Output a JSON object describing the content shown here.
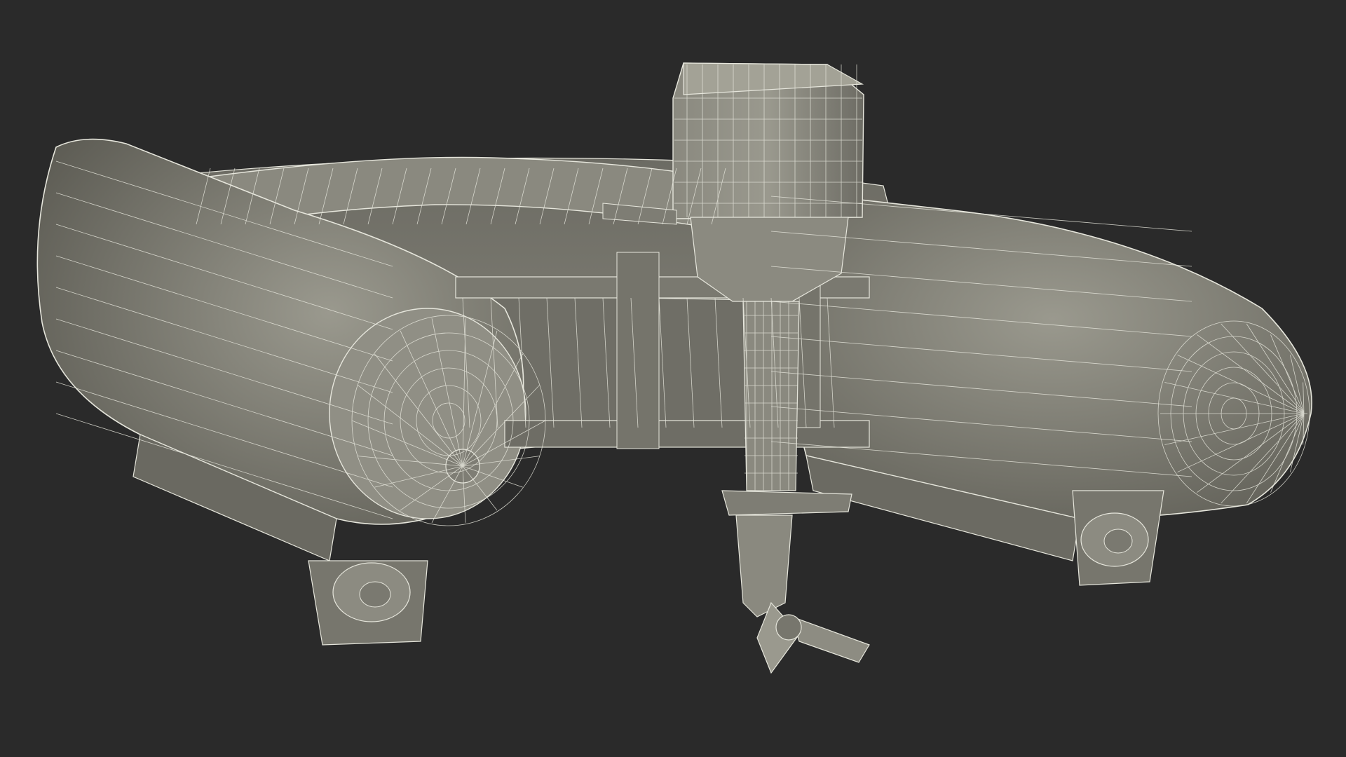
{
  "scene": {
    "background_color": "#2a2a2a",
    "surface_color": "#7d7c72",
    "surface_shadow_color": "#5b5a52",
    "surface_highlight_color": "#9a998e",
    "wire_color": "#e6e6dc",
    "subject": "inflatable-boat-with-outboard-motor-wireframe"
  }
}
